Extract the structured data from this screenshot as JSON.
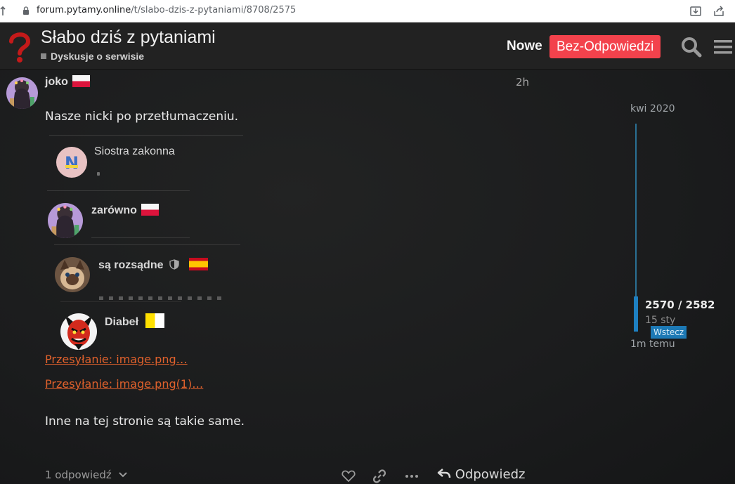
{
  "browser": {
    "url_host": "forum.pytamy.online",
    "url_path": "/t/slabo-dzis-z-pytaniami/8708/2575"
  },
  "header": {
    "title": "Słabo dziś z pytaniami",
    "category": "Dyskusje o serwisie",
    "nav_new": "Nowe",
    "nav_unanswered": "Bez-Odpowiedzi",
    "accent_color": "#f3424c"
  },
  "post": {
    "author": "joko",
    "time": "2h",
    "text": "Nasze nicki po przetłumaczeniu.",
    "quotes": [
      {
        "name": "Siostra zakonna"
      },
      {
        "name": "zarówno"
      },
      {
        "name": "są rozsądne"
      },
      {
        "name": "Diabeł"
      }
    ],
    "uploads": [
      "Przesyłanie: image.png…",
      "Przesyłanie: image.png(1)…"
    ],
    "text_end": "Inne na tej stronie są takie same.",
    "replies": "1 odpowiedź",
    "reply_button": "Odpowiedz"
  },
  "timeline": {
    "start": "kwi 2020",
    "position": "2570 / 2582",
    "date": "15 sty",
    "back": "Wstecz",
    "end": "1m temu"
  }
}
